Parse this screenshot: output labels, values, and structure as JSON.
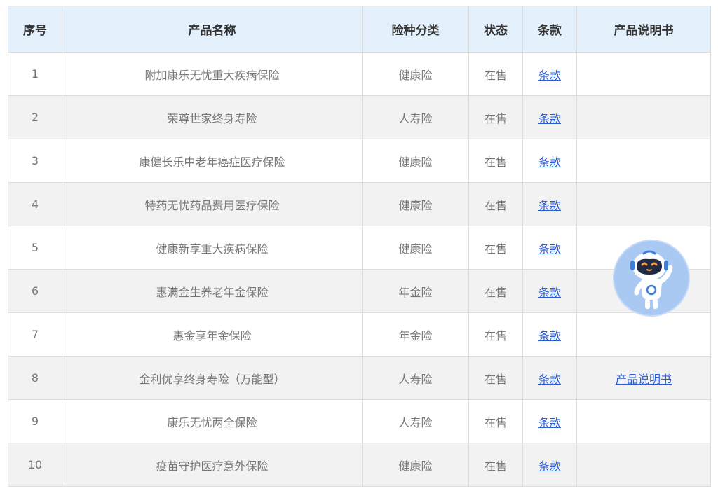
{
  "table": {
    "headers": [
      "序号",
      "产品名称",
      "险种分类",
      "状态",
      "条款",
      "产品说明书"
    ],
    "rows": [
      {
        "no": "1",
        "name": "附加康乐无忧重大疾病保险",
        "category": "健康险",
        "status": "在售",
        "clause": "条款",
        "manual": ""
      },
      {
        "no": "2",
        "name": "荣尊世家终身寿险",
        "category": "人寿险",
        "status": "在售",
        "clause": "条款",
        "manual": ""
      },
      {
        "no": "3",
        "name": "康健长乐中老年癌症医疗保险",
        "category": "健康险",
        "status": "在售",
        "clause": "条款",
        "manual": ""
      },
      {
        "no": "4",
        "name": "特药无忧药品费用医疗保险",
        "category": "健康险",
        "status": "在售",
        "clause": "条款",
        "manual": ""
      },
      {
        "no": "5",
        "name": "健康新享重大疾病保险",
        "category": "健康险",
        "status": "在售",
        "clause": "条款",
        "manual": ""
      },
      {
        "no": "6",
        "name": "惠满金生养老年金保险",
        "category": "年金险",
        "status": "在售",
        "clause": "条款",
        "manual": ""
      },
      {
        "no": "7",
        "name": "惠金享年金保险",
        "category": "年金险",
        "status": "在售",
        "clause": "条款",
        "manual": ""
      },
      {
        "no": "8",
        "name": "金利优享终身寿险（万能型）",
        "category": "人寿险",
        "status": "在售",
        "clause": "条款",
        "manual": "产品说明书"
      },
      {
        "no": "9",
        "name": "康乐无忧两全保险",
        "category": "人寿险",
        "status": "在售",
        "clause": "条款",
        "manual": ""
      },
      {
        "no": "10",
        "name": "疫苗守护医疗意外保险",
        "category": "健康险",
        "status": "在售",
        "clause": "条款",
        "manual": ""
      }
    ]
  },
  "colors": {
    "header_bg": "#e4f1fd",
    "alt_row_bg": "#f2f2f2",
    "link": "#2a5bd7",
    "border": "#dcdcdc"
  },
  "assistant": {
    "icon": "robot-assistant-icon"
  }
}
